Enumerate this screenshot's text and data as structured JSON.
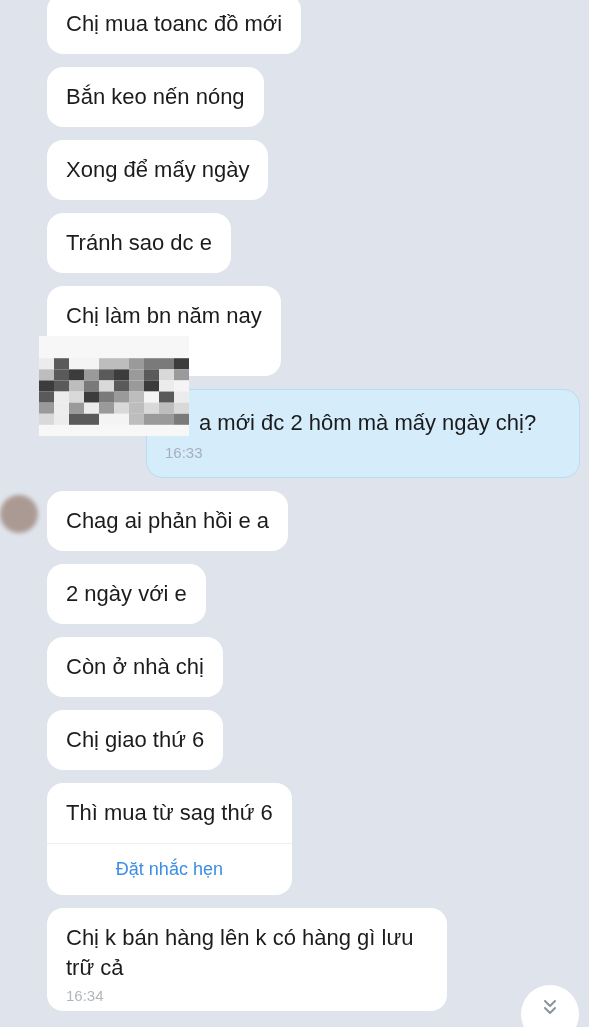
{
  "messages": [
    {
      "kind": "received",
      "text": "Chị mua toanc đồ mới"
    },
    {
      "kind": "received",
      "text": "Bắn keo nến nóng"
    },
    {
      "kind": "received",
      "text": "Xong để mấy ngày"
    },
    {
      "kind": "received",
      "text": "Tránh sao dc e"
    },
    {
      "kind": "received",
      "text": "Chị làm bn năm nay",
      "obscured": true
    },
    {
      "kind": "sent",
      "text": "a mới đc 2 hôm mà mấy ngày chị?",
      "time": "16:33"
    },
    {
      "kind": "received",
      "text": "Chag ai phản hồi e a",
      "avatar": true
    },
    {
      "kind": "received",
      "text": "2 ngày với e"
    },
    {
      "kind": "received",
      "text": "Còn ở nhà chị"
    },
    {
      "kind": "received",
      "text": "Chị giao thứ 6"
    },
    {
      "kind": "received",
      "text": "Thì mua từ sag thứ 6",
      "action": "Đặt nhắc hẹn"
    },
    {
      "kind": "received",
      "text": "Chị k bán hàng lên k có hàng gì lưu trữ cả",
      "time": "16:34"
    }
  ]
}
